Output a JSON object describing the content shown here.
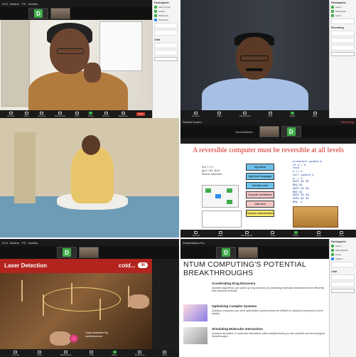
{
  "tile1": {
    "topbar": {
      "name": "Dr.G. Savitha",
      "sub": "PS - Savitha"
    },
    "thumb": {
      "letter": "D"
    },
    "name_tag": "",
    "panel": {
      "title": "Participants",
      "rows": [
        "Admin (host)",
        "Swathi",
        "Participant",
        "Participant"
      ],
      "chat_title": "Chat"
    }
  },
  "tile2": {
    "topbar": {
      "name": "Participants"
    },
    "panel": {
      "title": "Participants",
      "rows": [
        "Admin",
        "Dhanwantri",
        "Guest"
      ],
      "section": "Recording"
    }
  },
  "tile3": {},
  "tile4": {
    "topbar": {
      "name": "Shared Screen",
      "recording": "Recording"
    },
    "thumb_name": "Anomoblitcha",
    "thumb": {
      "letter": "D"
    },
    "slide_title": "A reversible computer must be reversible at all levels",
    "math_lines": [
      "f(x) = e^x",
      "g(x) = f(x, f(x))",
      "Fourier transform"
    ],
    "boxes": [
      "Algorithms",
      "High-level languages",
      "Machine code",
      "Computer architecture",
      "Gate level",
      "Physical implementation"
    ],
    "code_lines": [
      "procedure update_m",
      "  if a = b",
      "  then",
      "  a += b",
      "  call update_b",
      "  a -= b",
      "ADDI $2 $0",
      "BEQ $1",
      "ADDI $2 $3",
      "BNE $1",
      "ADDI $2 $3",
      "XORI $2 $2",
      "BRA -4"
    ]
  },
  "tile5": {
    "topbar": {
      "name": "Dr.G. Savitha",
      "sub": "PS - Savitha"
    },
    "thumb": {
      "letter": "D"
    },
    "header_title": "Laser Detection",
    "header_right": "cotd...",
    "pill": "56",
    "caption_line1": "Laser detected by",
    "caption_line2": "luminescence"
  },
  "tile6": {
    "topbar": {
      "name": "Shanthababu Pa..."
    },
    "thumb": {
      "letter": "D"
    },
    "title_line1": "NTUM COMPUTING'S POTENTIAL",
    "title_line2": "BREAKTHROUGHS",
    "items": [
      {
        "heading": "Accelerating Drug Discovery",
        "body": "Quantum algorithms can speed up drug discovery by simulating molecular interactions more efficiently than classical methods."
      },
      {
        "heading": "Optimizing Complex Systems",
        "body": "Quantum computers can solve optimization problems that are difficult for classical computers to solve quickly."
      },
      {
        "heading": "Simulating Molecular Interactions",
        "body": "Quantum simulation of molecular interactions offers insights leading to new scientific and technological breakthroughs."
      }
    ],
    "panel": {
      "title": "Participants",
      "rows": [
        "Admin",
        "Shanthababu",
        "Guest",
        "Student"
      ],
      "chat_title": "Chat"
    }
  },
  "toolbar": {
    "items": [
      "Unmute",
      "Video",
      "Security",
      "Participants",
      "Chat",
      "Share",
      "Record",
      "Reactions",
      "Apps",
      "More"
    ],
    "end": "End"
  },
  "colors": {
    "zoom_green": "#3fae49",
    "end_red": "#d63b2f",
    "slide_red": "#d4281f",
    "laser_red": "#b3241e"
  }
}
